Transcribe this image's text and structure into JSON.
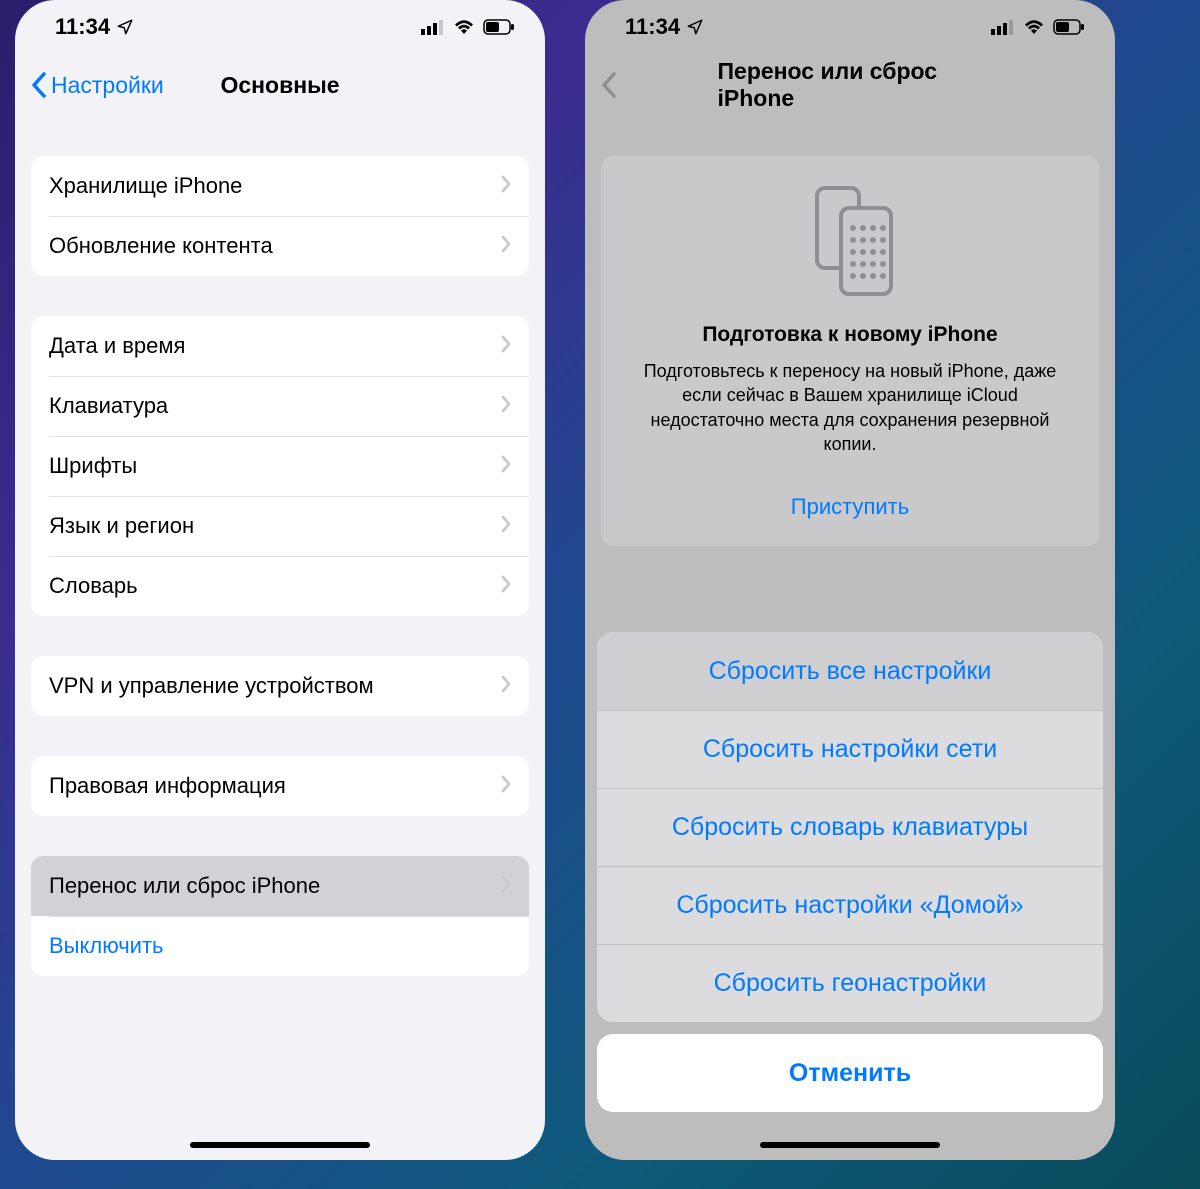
{
  "status": {
    "time": "11:34"
  },
  "left": {
    "back_label": "Настройки",
    "title": "Основные",
    "group1": [
      {
        "label": "Хранилище iPhone"
      },
      {
        "label": "Обновление контента"
      }
    ],
    "group2": [
      {
        "label": "Дата и время"
      },
      {
        "label": "Клавиатура"
      },
      {
        "label": "Шрифты"
      },
      {
        "label": "Язык и регион"
      },
      {
        "label": "Словарь"
      }
    ],
    "group3": [
      {
        "label": "VPN и управление устройством"
      }
    ],
    "group4": [
      {
        "label": "Правовая информация"
      }
    ],
    "group5": {
      "transfer": "Перенос или сброс iPhone",
      "shutdown": "Выключить"
    }
  },
  "right": {
    "title": "Перенос или сброс iPhone",
    "prepare": {
      "title": "Подготовка к новому iPhone",
      "desc": "Подготовьтесь к переносу на новый iPhone, даже если сейчас в Вашем хранилище iCloud недостаточно места для сохранения резервной копии.",
      "action": "Приступить"
    },
    "sheet": [
      "Сбросить все настройки",
      "Сбросить настройки сети",
      "Сбросить словарь клавиатуры",
      "Сбросить настройки «Домой»",
      "Сбросить геонастройки"
    ],
    "cancel": "Отменить"
  }
}
